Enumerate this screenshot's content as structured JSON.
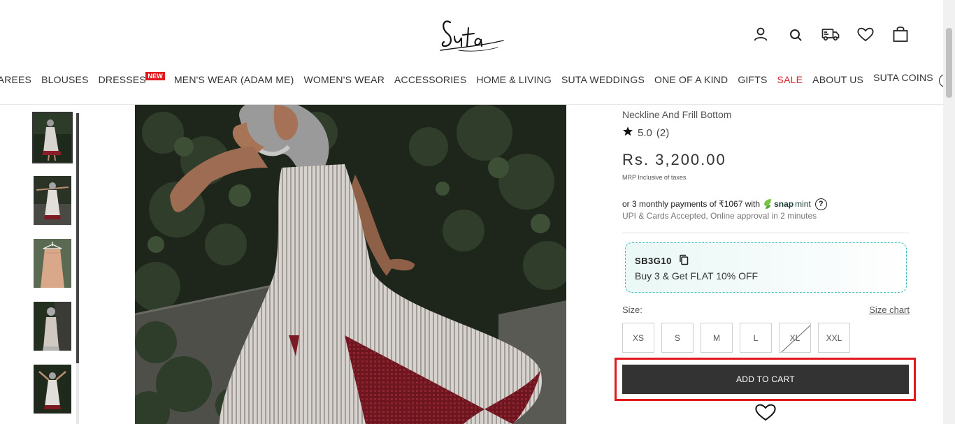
{
  "brand": {
    "logo_text": "Suta"
  },
  "header_icons": [
    "user-icon",
    "search-icon",
    "truck-icon",
    "heart-icon",
    "bag-icon"
  ],
  "nav": {
    "items": [
      {
        "label": "SAREES"
      },
      {
        "label": "BLOUSES"
      },
      {
        "label": "DRESSES",
        "badge": "NEW"
      },
      {
        "label": "MEN'S WEAR (ADAM ME)"
      },
      {
        "label": "WOMEN'S WEAR"
      },
      {
        "label": "ACCESSORIES"
      },
      {
        "label": "HOME & LIVING"
      },
      {
        "label": "SUTA WEDDINGS"
      },
      {
        "label": "ONE OF A KIND"
      },
      {
        "label": "GIFTS"
      },
      {
        "label": "SALE",
        "color": "#d9272e"
      },
      {
        "label": "ABOUT US"
      },
      {
        "label": "SUTA COINS",
        "icon": "coin-icon",
        "icon_text": "$"
      }
    ]
  },
  "product": {
    "subtitle": "Neckline And Frill Bottom",
    "rating": {
      "value": "5.0",
      "count": "(2)"
    },
    "price": "Rs. 3,200.00",
    "mrp_note": "MRP Inclusive of taxes",
    "emi": {
      "text": "or 3 monthly payments of ₹1067 with",
      "provider_bold": "snap",
      "provider_rest": "mint",
      "help": "?"
    },
    "upi_note": "UPI & Cards Accepted, Online approval in 2 minutes",
    "coupon": {
      "code": "SB3G10",
      "description": "Buy 3 & Get FLAT 10% OFF"
    },
    "size_label": "Size:",
    "size_chart_label": "Size chart",
    "sizes": [
      {
        "label": "XS",
        "available": true
      },
      {
        "label": "S",
        "available": true
      },
      {
        "label": "M",
        "available": true
      },
      {
        "label": "L",
        "available": true
      },
      {
        "label": "XL",
        "available": false
      },
      {
        "label": "XXL",
        "available": true
      }
    ],
    "add_to_cart_label": "ADD TO CART"
  },
  "colors": {
    "accent_red": "#e3171e",
    "button_dark": "#333333",
    "coupon_border": "#3bbdbd"
  }
}
